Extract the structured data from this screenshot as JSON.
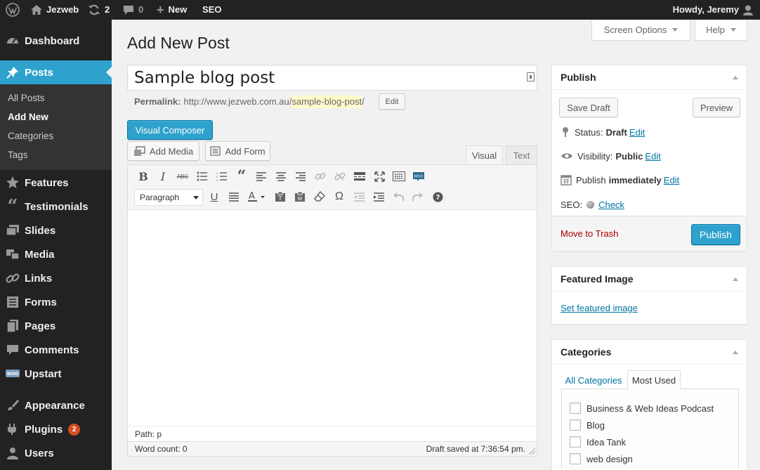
{
  "adminbar": {
    "wp_logo_icon": "wordpress-icon",
    "site_name": "Jezweb",
    "updates_count": "2",
    "comments_count": "0",
    "new_label": "New",
    "seo_label": "SEO",
    "howdy": "Howdy, Jeremy"
  },
  "sidebar": {
    "items": [
      {
        "label": "Dashboard",
        "icon": "dashboard-icon"
      },
      {
        "label": "Posts",
        "icon": "pin-icon"
      },
      {
        "label": "Features",
        "icon": "star-icon"
      },
      {
        "label": "Testimonials",
        "icon": "quote-icon"
      },
      {
        "label": "Slides",
        "icon": "slides-icon"
      },
      {
        "label": "Media",
        "icon": "media-icon"
      },
      {
        "label": "Links",
        "icon": "link-icon"
      },
      {
        "label": "Forms",
        "icon": "forms-icon"
      },
      {
        "label": "Pages",
        "icon": "pages-icon"
      },
      {
        "label": "Comments",
        "icon": "comment-icon"
      },
      {
        "label": "Upstart",
        "icon": "woo-icon"
      },
      {
        "label": "Appearance",
        "icon": "brush-icon"
      },
      {
        "label": "Plugins",
        "icon": "plugin-icon",
        "badge": "2"
      },
      {
        "label": "Users",
        "icon": "user-icon"
      }
    ],
    "posts_submenu": [
      "All Posts",
      "Add New",
      "Categories",
      "Tags"
    ]
  },
  "screen_options_label": "Screen Options",
  "help_label": "Help",
  "page_title": "Add New Post",
  "post_title": "Sample blog post",
  "permalink": {
    "label": "Permalink:",
    "base": "http://www.jezweb.com.au/",
    "slug": "sample-blog-post",
    "trailing": "/",
    "edit_label": "Edit"
  },
  "visual_composer_label": "Visual Composer",
  "add_media_label": "Add Media",
  "add_form_label": "Add Form",
  "editor": {
    "tab_visual": "Visual",
    "tab_text": "Text",
    "format_value": "Paragraph",
    "path": "Path: p",
    "word_count": "Word count: 0",
    "draft_saved": "Draft saved at 7:36:54 pm.",
    "toolbar_row1": [
      "bold-icon",
      "italic-icon",
      "strikethrough-icon",
      "bullet-list-icon",
      "numbered-list-icon",
      "blockquote-icon",
      "align-left-icon",
      "align-center-icon",
      "align-right-icon",
      "insert-link-icon",
      "unlink-icon",
      "read-more-icon",
      "fullscreen-icon",
      "toolbar-toggle-icon",
      "woo-shortcode-icon"
    ],
    "toolbar_row2": [
      "underline-icon",
      "justify-icon",
      "text-color-icon",
      "paste-text-icon",
      "paste-word-icon",
      "clear-format-icon",
      "special-char-icon",
      "outdent-icon",
      "indent-icon",
      "undo-icon",
      "redo-icon",
      "help-icon"
    ]
  },
  "publish_box": {
    "title": "Publish",
    "save_draft": "Save Draft",
    "preview": "Preview",
    "status_label": "Status:",
    "status_value": "Draft",
    "visibility_label": "Visibility:",
    "visibility_value": "Public",
    "publish_label": "Publish",
    "publish_value": "immediately",
    "edit": "Edit",
    "seo_label": "SEO:",
    "seo_check": "Check",
    "trash": "Move to Trash",
    "publish_button": "Publish"
  },
  "featured_box": {
    "title": "Featured Image",
    "link": "Set featured image"
  },
  "categories_box": {
    "title": "Categories",
    "tab_all": "All Categories",
    "tab_most_used": "Most Used",
    "items": [
      "Business & Web Ideas Podcast",
      "Blog",
      "Idea Tank",
      "web design"
    ]
  },
  "colors": {
    "admin_bar": "#222222",
    "sidebar": "#222222",
    "accent": "#2ea2cc",
    "link": "#0074a2",
    "trash": "#aa0000",
    "badge": "#d54e21"
  }
}
